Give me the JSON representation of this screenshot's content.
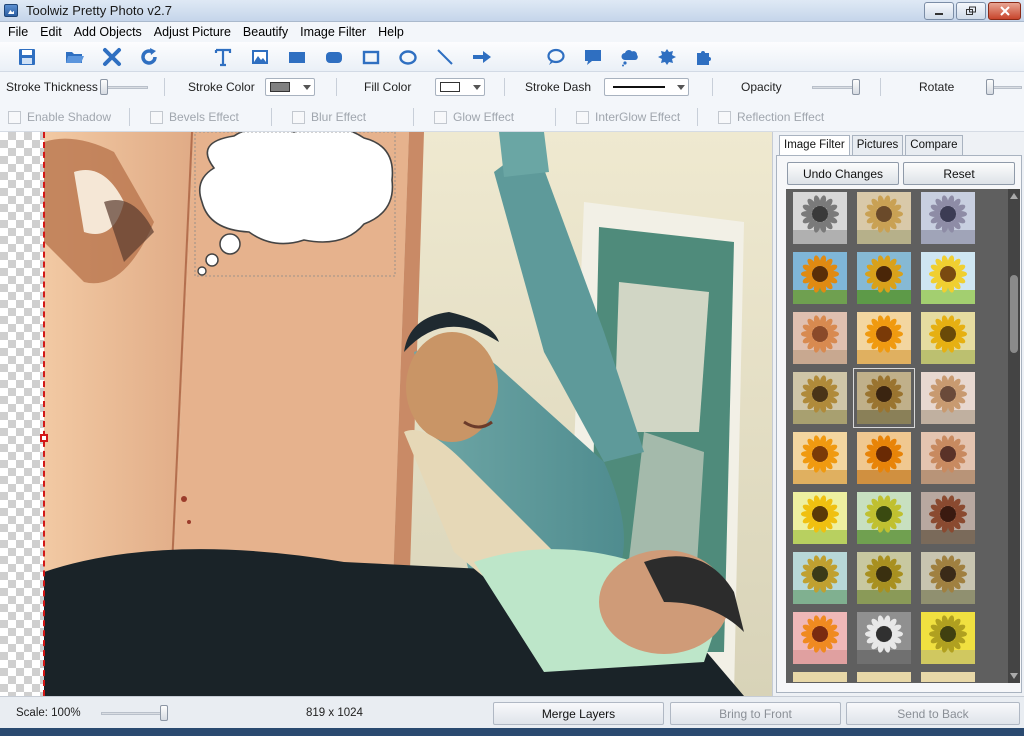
{
  "window": {
    "title": "Toolwiz Pretty Photo v2.7"
  },
  "menu": [
    "File",
    "Edit",
    "Add Objects",
    "Adjust Picture",
    "Beautify",
    "Image Filter",
    "Help"
  ],
  "toolbar": {
    "tools": [
      "save-icon",
      "open-folder-icon",
      "delete-icon",
      "refresh-icon",
      "text-icon",
      "image-icon",
      "rect-fill-icon",
      "rounded-rect-icon",
      "rect-outline-icon",
      "ellipse-icon",
      "line-icon",
      "arrow-icon",
      "speech-bubble-icon",
      "callout-icon",
      "cloud-bubble-icon",
      "burst-icon",
      "puzzle-icon"
    ]
  },
  "props": {
    "stroke_thickness": "Stroke Thickness",
    "stroke_color": "Stroke Color",
    "fill_color": "Fill Color",
    "stroke_dash": "Stroke Dash",
    "opacity": "Opacity",
    "rotate": "Rotate",
    "stroke_color_value": "#808080",
    "fill_color_value": "#ffffff"
  },
  "effects": [
    "Enable Shadow",
    "Bevels Effect",
    "Blur Effect",
    "Glow Effect",
    "InterGlow Effect",
    "Reflection Effect"
  ],
  "panel": {
    "tabs": [
      "Image Filter",
      "Pictures",
      "Compare"
    ],
    "undo_label": "Undo Changes",
    "reset_label": "Reset"
  },
  "status": {
    "scale": "Scale: 100%",
    "dimensions": "819 x 1024",
    "merge_label": "Merge Layers",
    "front_label": "Bring to Front",
    "back_label": "Send to Back"
  },
  "filters": [
    [
      "gray",
      "warm",
      "cool"
    ],
    [
      "vivid",
      "sharp",
      "bright"
    ],
    [
      "faded",
      "orange",
      "gold"
    ],
    [
      "sepia",
      "sepia-dark",
      "soft"
    ],
    [
      "orange",
      "deep-orange",
      "mauve"
    ],
    [
      "yellow",
      "green",
      "dark"
    ],
    [
      "teal",
      "olive",
      "muted"
    ],
    [
      "pink",
      "mono",
      "noise"
    ]
  ]
}
